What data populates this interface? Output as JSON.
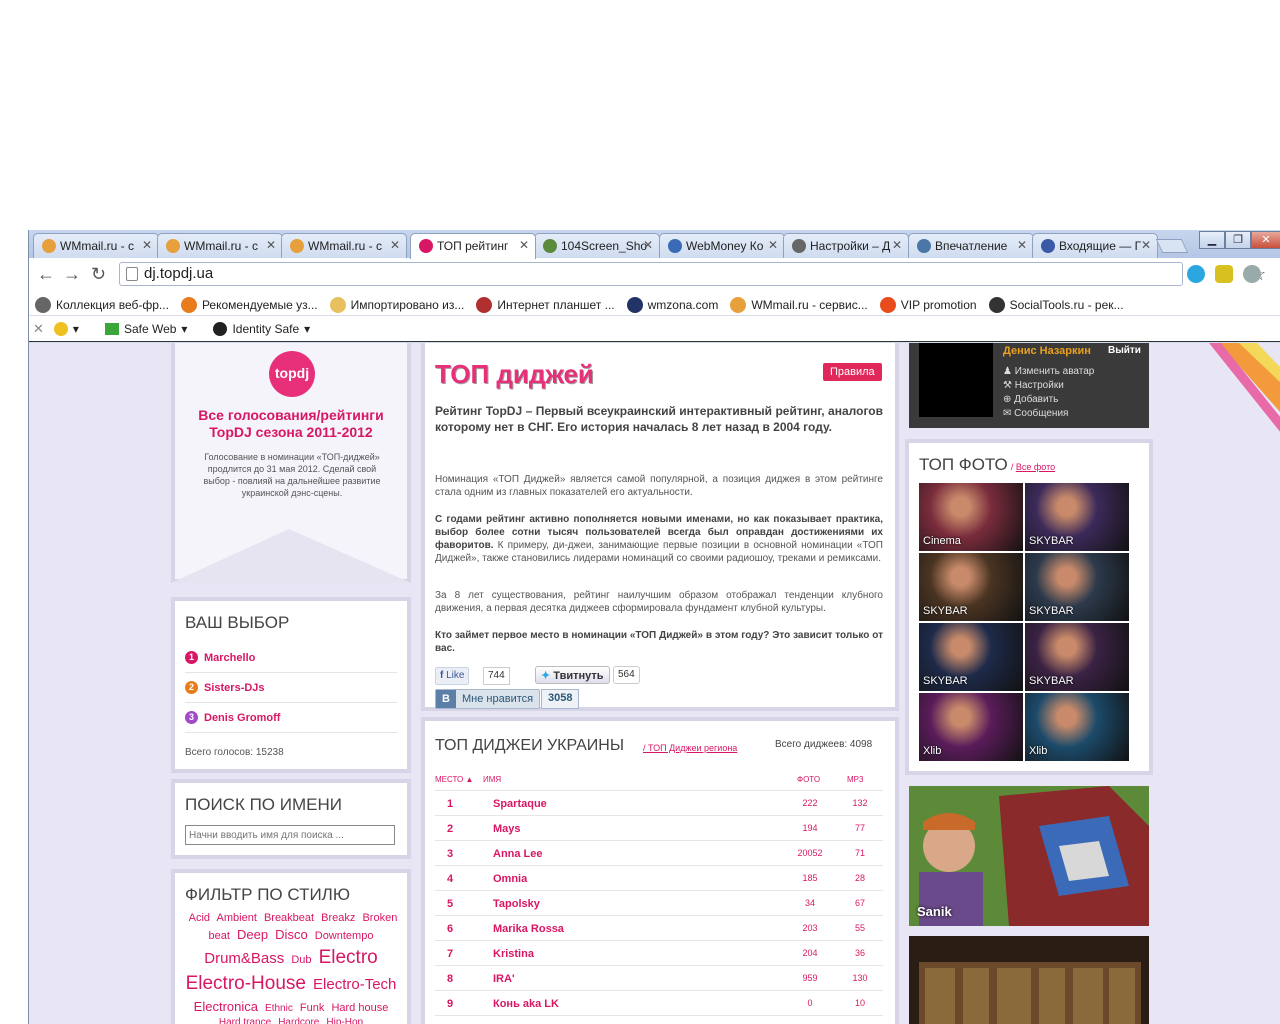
{
  "browser": {
    "tabs": [
      {
        "label": "WMmail.ru - с",
        "icon_color": "#e8a03c"
      },
      {
        "label": "WMmail.ru - с",
        "icon_color": "#e8a03c"
      },
      {
        "label": "WMmail.ru - с",
        "icon_color": "#e8a03c"
      },
      {
        "label": "ТОП рейтинг",
        "icon_color": "#d81764"
      },
      {
        "label": "104Screen_Sho",
        "icon_color": "#5a8a3c"
      },
      {
        "label": "WebMoney Ко",
        "icon_color": "#3a6ab8"
      },
      {
        "label": "Настройки – Д",
        "icon_color": "#666666"
      },
      {
        "label": "Впечатление",
        "icon_color": "#4a76a8"
      },
      {
        "label": "Входящие — Г",
        "icon_color": "#3a5aa8"
      }
    ],
    "url": "dj.topdj.ua",
    "bookmarks": [
      {
        "label": "Коллекция веб-фр...",
        "icon_color": "#666666"
      },
      {
        "label": "Рекомендуемые уз...",
        "icon_color": "#e87c1c"
      },
      {
        "label": "Импортировано из...",
        "icon_color": "#e8c060"
      },
      {
        "label": "Интернет планшет ...",
        "icon_color": "#b03030"
      },
      {
        "label": "wmzona.com",
        "icon_color": "#223366"
      },
      {
        "label": "WMmail.ru - сервис...",
        "icon_color": "#e8a03c"
      },
      {
        "label": "VIP promotion",
        "icon_color": "#e84c1c"
      },
      {
        "label": "SocialTools.ru - рек...",
        "icon_color": "#333333"
      }
    ],
    "norton": {
      "safe_web": "Safe Web",
      "identity_safe": "Identity Safe"
    }
  },
  "left": {
    "logo": "topdj",
    "promo_title": "Все голосования/рейтинги TopDJ сезона 2011-2012",
    "promo_text": "Голосование в номинации «ТОП-диджей» продлится до 31 мая 2012. Сделай свой выбор - повлияй на дальнейшее развитие украинской дэнс-сцены.",
    "choice_title": "ВАШ ВЫБОР",
    "choices": [
      {
        "num": "1",
        "name": "Marchello",
        "color": "#d81764"
      },
      {
        "num": "2",
        "name": "Sisters-DJs",
        "color": "#e87c1c"
      },
      {
        "num": "3",
        "name": "Denis Gromoff",
        "color": "#a04cc8"
      }
    ],
    "total_votes": "Всего голосов: 15238",
    "search_title": "ПОИСК ПО ИМЕНИ",
    "search_placeholder": "Начни вводить имя для поиска ...",
    "filter_title": "ФИЛЬТР ПО СТИЛЮ",
    "tags": [
      {
        "t": "Acid",
        "s": 11
      },
      {
        "t": "Ambient",
        "s": 11
      },
      {
        "t": "Breakbeat",
        "s": 11
      },
      {
        "t": "Breakz",
        "s": 11
      },
      {
        "t": "Broken beat",
        "s": 11
      },
      {
        "t": "Deep",
        "s": 13
      },
      {
        "t": "Disco",
        "s": 13
      },
      {
        "t": "Downtempo",
        "s": 11
      },
      {
        "t": "Drum&Bass",
        "s": 15
      },
      {
        "t": "Dub",
        "s": 11
      },
      {
        "t": "Electro",
        "s": 19
      },
      {
        "t": "Electro-House",
        "s": 19
      },
      {
        "t": "Electro-Tech",
        "s": 15
      },
      {
        "t": "Electronica",
        "s": 13
      },
      {
        "t": "Ethnic",
        "s": 10
      },
      {
        "t": "Funk",
        "s": 11
      },
      {
        "t": "Hard house",
        "s": 11
      },
      {
        "t": "Hard trance",
        "s": 10
      },
      {
        "t": "Hardcore",
        "s": 10
      },
      {
        "t": "Hip-Hop",
        "s": 10
      }
    ]
  },
  "main": {
    "title": "ТОП диджей",
    "rules_button": "Правила",
    "lead": "Рейтинг TopDJ – Первый всеукраинский интерактивный рейтинг, аналогов которому нет в СНГ. Его история началась 8 лет назад в 2004 году.",
    "p1": "Номинация «ТОП Диджей» является самой популярной, а позиция диджея в этом рейтинге стала одним из главных показателей его актуальности.",
    "p2_bold": "С годами рейтинг активно пополняется новыми именами, но как показывает практика, выбор более сотни тысяч пользователей всегда был оправдан достижениями их фаворитов.",
    "p2_rest": " К примеру, ди-джеи, занимающие первые позиции в основной номинации «ТОП Диджей», также становились лидерами номинаций со своими радиошоу, треками и ремиксами.",
    "p3": "За 8 лет существования, рейтинг наилучшим образом отображал тенденции клубного движения, а первая десятка диджеев сформировала фундамент клубной культуры.",
    "p4": "Кто займет первое место в номинации «ТОП Диджей» в этом году? Это зависит только от вас.",
    "fb_like": "Like",
    "fb_count": "744",
    "tweet": "Твитнуть",
    "tweet_count": "564",
    "vk_like": "Мне нравится",
    "vk_count": "3058"
  },
  "ranking": {
    "title": "ТОП ДИДЖЕИ УКРАИНЫ",
    "region_link": "ТОП Диджеи региона",
    "total": "Всего диджеев: 4098",
    "headers": {
      "place": "МЕСТО",
      "name": "ИМЯ",
      "photo": "ФОТО",
      "mp3": "MP3"
    },
    "rows": [
      {
        "place": "1",
        "name": "Spartaque",
        "photo": "222",
        "mp3": "132"
      },
      {
        "place": "2",
        "name": "Mays",
        "photo": "194",
        "mp3": "77"
      },
      {
        "place": "3",
        "name": "Anna Lee",
        "photo": "20052",
        "mp3": "71"
      },
      {
        "place": "4",
        "name": "Omnia",
        "photo": "185",
        "mp3": "28"
      },
      {
        "place": "5",
        "name": "Tapolsky",
        "photo": "34",
        "mp3": "67"
      },
      {
        "place": "6",
        "name": "Marika Rossa",
        "photo": "203",
        "mp3": "55"
      },
      {
        "place": "7",
        "name": "Kristina",
        "photo": "204",
        "mp3": "36"
      },
      {
        "place": "8",
        "name": "IRA'",
        "photo": "959",
        "mp3": "130"
      },
      {
        "place": "9",
        "name": "Конь aka LK",
        "photo": "0",
        "mp3": "10"
      }
    ]
  },
  "right": {
    "user_name": "Денис Назаркин",
    "logout": "Выйти",
    "menu": [
      "Изменить аватар",
      "Настройки",
      "Добавить",
      "Сообщения"
    ],
    "photo_title": "ТОП ФОТО",
    "photo_link": "Все фото",
    "photos": [
      {
        "label": "Cinema",
        "color": "#7a2c3c"
      },
      {
        "label": "SKYBAR",
        "color": "#3c2a5a"
      },
      {
        "label": "SKYBAR",
        "color": "#4a3422"
      },
      {
        "label": "SKYBAR",
        "color": "#2c3a4c"
      },
      {
        "label": "SKYBAR",
        "color": "#1e2a4a"
      },
      {
        "label": "SKYBAR",
        "color": "#3a2244"
      },
      {
        "label": "Xlib",
        "color": "#5a1c5a"
      },
      {
        "label": "Xlib",
        "color": "#1c4a6a"
      }
    ],
    "banner_name": "Sanik"
  }
}
